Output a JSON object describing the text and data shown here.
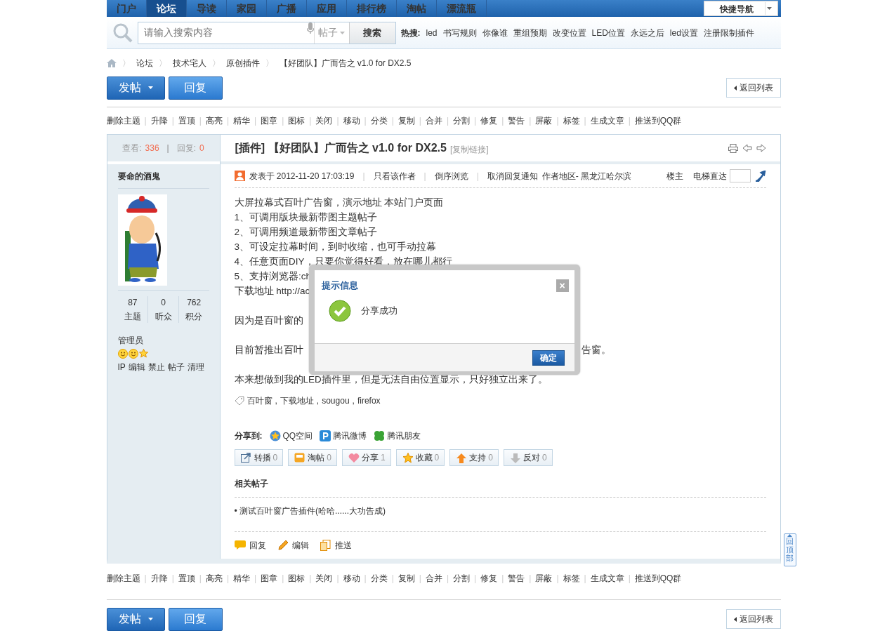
{
  "top_nav": {
    "items": [
      {
        "label": "门户",
        "selected": false
      },
      {
        "label": "论坛",
        "selected": true
      },
      {
        "label": "导读",
        "selected": false
      },
      {
        "label": "家园",
        "selected": false
      },
      {
        "label": "广播",
        "selected": false
      },
      {
        "label": "应用",
        "selected": false
      },
      {
        "label": "排行榜",
        "selected": false
      },
      {
        "label": "淘帖",
        "selected": false
      },
      {
        "label": "漂流瓶",
        "selected": false
      }
    ],
    "quick_nav": "快捷导航"
  },
  "search": {
    "placeholder": "请输入搜索内容",
    "scope": "帖子",
    "button": "搜索",
    "hot_label": "热搜:",
    "hot": [
      "led",
      "书写规则",
      "你像谁",
      "重组预期",
      "改变位置",
      "LED位置",
      "永远之后",
      "led设置",
      "注册限制插件"
    ]
  },
  "breadcrumb": [
    "论坛",
    "技术宅人",
    "原创插件",
    "【好团队】广而告之 v1.0 for DX2.5"
  ],
  "top_buttons": {
    "new_post": "发帖",
    "reply": "回复",
    "back": "返回列表"
  },
  "top_mod_actions": [
    "删除主题",
    "升降",
    "置顶",
    "高亮",
    "精华",
    "图章",
    "图标",
    "关闭",
    "移动",
    "分类",
    "复制",
    "合并",
    "分割",
    "修复",
    "警告",
    "屏蔽",
    "标签",
    "生成文章",
    "推送到QQ群"
  ],
  "post": {
    "views_label": "查看:",
    "views": "336",
    "replies_label": "回复:",
    "replies": "0",
    "title": "[插件] 【好团队】广而告之 v1.0 for DX2.5",
    "copy_link": "[复制链接]",
    "author": {
      "name": "要命的酒鬼",
      "stats": [
        {
          "value": "87",
          "label": "主题"
        },
        {
          "value": "0",
          "label": "听众"
        },
        {
          "value": "762",
          "label": "积分"
        }
      ],
      "group": "管理员",
      "admin_links": [
        "IP",
        "编辑",
        "禁止",
        "帖子",
        "清理"
      ]
    },
    "meta": {
      "posted": "发表于 2012-11-20 17:03:19",
      "links": [
        "只看该作者",
        "倒序浏览"
      ],
      "notify": "取消回复通知",
      "region": "作者地区- 黑龙江哈尔滨",
      "floor": "楼主",
      "jump_label": "电梯直达"
    },
    "paragraphs": [
      [
        {
          "text": "大屏拉幕式百叶广告窗，演示地址 ",
          "link": "本站门户页面"
        },
        {
          "text": "1、可调用版块最新带图主题帖子"
        },
        {
          "text": "2、可调用频道最新带图文章帖子"
        },
        {
          "text": "3、可设定拉幕时间，到时收缩，也可手动拉幕"
        },
        {
          "text": "4、任意页面DIY，只要你觉得好看，放在哪儿都行"
        },
        {
          "text": "5、支持浏览器:ch"
        },
        {
          "text": "下载地址 ",
          "link": "http://ac"
        }
      ],
      [
        {
          "text": "因为是百叶窗的"
        }
      ],
      [
        {
          "text": "目前暂推出百叶",
          "tail": "告窗。"
        }
      ],
      [
        {
          "text": "本来想做到我的LED插件里，但是无法自由位置显示，只好独立出来了。"
        }
      ]
    ],
    "tags": [
      "百叶窗",
      "下载地址",
      "sougou",
      "firefox"
    ],
    "tag_separator": ",",
    "share_label": "分享到:",
    "share_targets": [
      "QQ空间",
      "腾讯微博",
      "腾讯朋友"
    ],
    "actions": [
      {
        "label": "转播",
        "count": "0"
      },
      {
        "label": "淘帖",
        "count": "0"
      },
      {
        "label": "分享",
        "count": "1"
      },
      {
        "label": "收藏",
        "count": "0"
      },
      {
        "label": "支持",
        "count": "0"
      },
      {
        "label": "反对",
        "count": "0"
      }
    ],
    "related_title": "相关帖子",
    "related": [
      "• 测试百叶窗广告插件(哈哈......大功告成)"
    ],
    "footer_actions": [
      "回复",
      "编辑",
      "推送"
    ]
  },
  "bottom_mod_actions": [
    "删除主题",
    "升降",
    "置顶",
    "高亮",
    "精华",
    "图章",
    "图标",
    "关闭",
    "移动",
    "分类",
    "复制",
    "合并",
    "分割",
    "修复",
    "警告",
    "屏蔽",
    "标签",
    "生成文章",
    "推送到QQ群"
  ],
  "bottom_buttons": {
    "new_post": "发帖",
    "reply": "回复",
    "back": "返回列表"
  },
  "dialog": {
    "title": "提示信息",
    "close": "×",
    "message": "分享成功",
    "ok": "确定"
  },
  "back_to_top": "回顶部",
  "separator": "|",
  "breadcrumb_separator": "〉"
}
